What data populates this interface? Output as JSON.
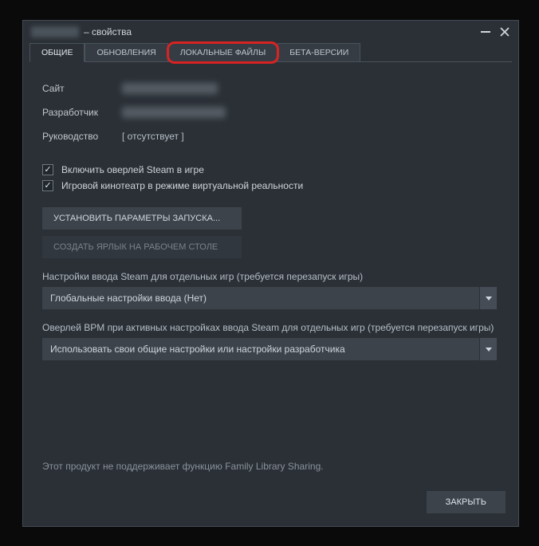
{
  "titlebar": {
    "suffix": "– свойства"
  },
  "tabs": {
    "general": "ОБЩИЕ",
    "updates": "ОБНОВЛЕНИЯ",
    "local_files": "ЛОКАЛЬНЫЕ ФАЙЛЫ",
    "betas": "БЕТА-ВЕРСИИ"
  },
  "fields": {
    "site_label": "Сайт",
    "developer_label": "Разработчик",
    "manual_label": "Руководство",
    "manual_value": "[ отсутствует ]"
  },
  "checkboxes": {
    "overlay": "Включить оверлей Steam в игре",
    "vr_theater": "Игровой кинотеатр в режиме виртуальной реальности"
  },
  "buttons": {
    "launch_options": "УСТАНОВИТЬ ПАРАМЕТРЫ ЗАПУСКА...",
    "desktop_shortcut": "СОЗДАТЬ ЯРЛЫК НА РАБОЧЕМ СТОЛЕ",
    "close": "ЗАКРЫТЬ"
  },
  "input": {
    "section1_label": "Настройки ввода Steam для отдельных игр (требуется перезапуск игры)",
    "dropdown1_value": "Глобальные настройки ввода (Нет)",
    "section2_label": "Оверлей BPM при активных настройках ввода Steam для отдельных игр (требуется перезапуск игры)",
    "dropdown2_value": "Использовать свои общие настройки или настройки разработчика"
  },
  "footer": {
    "note": "Этот продукт не поддерживает функцию Family Library Sharing."
  }
}
